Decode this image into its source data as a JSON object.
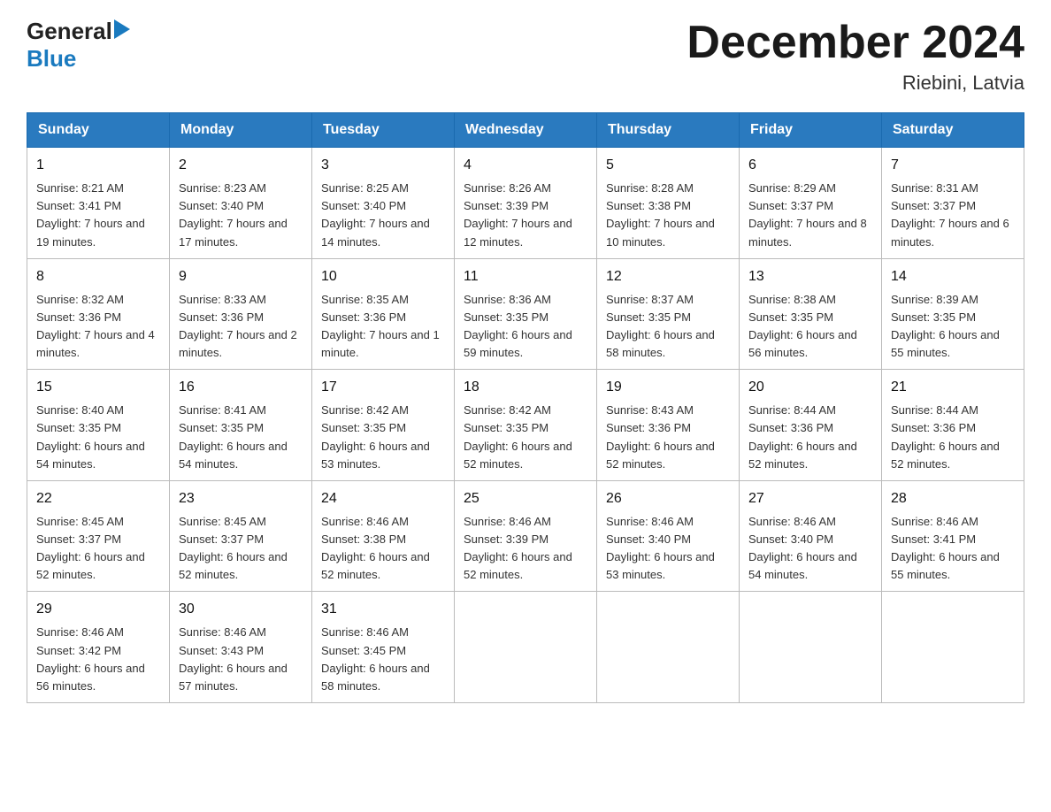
{
  "header": {
    "logo_general": "General",
    "logo_blue": "Blue",
    "month_title": "December 2024",
    "location": "Riebini, Latvia"
  },
  "days_of_week": [
    "Sunday",
    "Monday",
    "Tuesday",
    "Wednesday",
    "Thursday",
    "Friday",
    "Saturday"
  ],
  "weeks": [
    [
      {
        "day": "1",
        "sunrise": "8:21 AM",
        "sunset": "3:41 PM",
        "daylight": "7 hours and 19 minutes."
      },
      {
        "day": "2",
        "sunrise": "8:23 AM",
        "sunset": "3:40 PM",
        "daylight": "7 hours and 17 minutes."
      },
      {
        "day": "3",
        "sunrise": "8:25 AM",
        "sunset": "3:40 PM",
        "daylight": "7 hours and 14 minutes."
      },
      {
        "day": "4",
        "sunrise": "8:26 AM",
        "sunset": "3:39 PM",
        "daylight": "7 hours and 12 minutes."
      },
      {
        "day": "5",
        "sunrise": "8:28 AM",
        "sunset": "3:38 PM",
        "daylight": "7 hours and 10 minutes."
      },
      {
        "day": "6",
        "sunrise": "8:29 AM",
        "sunset": "3:37 PM",
        "daylight": "7 hours and 8 minutes."
      },
      {
        "day": "7",
        "sunrise": "8:31 AM",
        "sunset": "3:37 PM",
        "daylight": "7 hours and 6 minutes."
      }
    ],
    [
      {
        "day": "8",
        "sunrise": "8:32 AM",
        "sunset": "3:36 PM",
        "daylight": "7 hours and 4 minutes."
      },
      {
        "day": "9",
        "sunrise": "8:33 AM",
        "sunset": "3:36 PM",
        "daylight": "7 hours and 2 minutes."
      },
      {
        "day": "10",
        "sunrise": "8:35 AM",
        "sunset": "3:36 PM",
        "daylight": "7 hours and 1 minute."
      },
      {
        "day": "11",
        "sunrise": "8:36 AM",
        "sunset": "3:35 PM",
        "daylight": "6 hours and 59 minutes."
      },
      {
        "day": "12",
        "sunrise": "8:37 AM",
        "sunset": "3:35 PM",
        "daylight": "6 hours and 58 minutes."
      },
      {
        "day": "13",
        "sunrise": "8:38 AM",
        "sunset": "3:35 PM",
        "daylight": "6 hours and 56 minutes."
      },
      {
        "day": "14",
        "sunrise": "8:39 AM",
        "sunset": "3:35 PM",
        "daylight": "6 hours and 55 minutes."
      }
    ],
    [
      {
        "day": "15",
        "sunrise": "8:40 AM",
        "sunset": "3:35 PM",
        "daylight": "6 hours and 54 minutes."
      },
      {
        "day": "16",
        "sunrise": "8:41 AM",
        "sunset": "3:35 PM",
        "daylight": "6 hours and 54 minutes."
      },
      {
        "day": "17",
        "sunrise": "8:42 AM",
        "sunset": "3:35 PM",
        "daylight": "6 hours and 53 minutes."
      },
      {
        "day": "18",
        "sunrise": "8:42 AM",
        "sunset": "3:35 PM",
        "daylight": "6 hours and 52 minutes."
      },
      {
        "day": "19",
        "sunrise": "8:43 AM",
        "sunset": "3:36 PM",
        "daylight": "6 hours and 52 minutes."
      },
      {
        "day": "20",
        "sunrise": "8:44 AM",
        "sunset": "3:36 PM",
        "daylight": "6 hours and 52 minutes."
      },
      {
        "day": "21",
        "sunrise": "8:44 AM",
        "sunset": "3:36 PM",
        "daylight": "6 hours and 52 minutes."
      }
    ],
    [
      {
        "day": "22",
        "sunrise": "8:45 AM",
        "sunset": "3:37 PM",
        "daylight": "6 hours and 52 minutes."
      },
      {
        "day": "23",
        "sunrise": "8:45 AM",
        "sunset": "3:37 PM",
        "daylight": "6 hours and 52 minutes."
      },
      {
        "day": "24",
        "sunrise": "8:46 AM",
        "sunset": "3:38 PM",
        "daylight": "6 hours and 52 minutes."
      },
      {
        "day": "25",
        "sunrise": "8:46 AM",
        "sunset": "3:39 PM",
        "daylight": "6 hours and 52 minutes."
      },
      {
        "day": "26",
        "sunrise": "8:46 AM",
        "sunset": "3:40 PM",
        "daylight": "6 hours and 53 minutes."
      },
      {
        "day": "27",
        "sunrise": "8:46 AM",
        "sunset": "3:40 PM",
        "daylight": "6 hours and 54 minutes."
      },
      {
        "day": "28",
        "sunrise": "8:46 AM",
        "sunset": "3:41 PM",
        "daylight": "6 hours and 55 minutes."
      }
    ],
    [
      {
        "day": "29",
        "sunrise": "8:46 AM",
        "sunset": "3:42 PM",
        "daylight": "6 hours and 56 minutes."
      },
      {
        "day": "30",
        "sunrise": "8:46 AM",
        "sunset": "3:43 PM",
        "daylight": "6 hours and 57 minutes."
      },
      {
        "day": "31",
        "sunrise": "8:46 AM",
        "sunset": "3:45 PM",
        "daylight": "6 hours and 58 minutes."
      },
      null,
      null,
      null,
      null
    ]
  ],
  "labels": {
    "sunrise": "Sunrise:",
    "sunset": "Sunset:",
    "daylight": "Daylight:"
  }
}
